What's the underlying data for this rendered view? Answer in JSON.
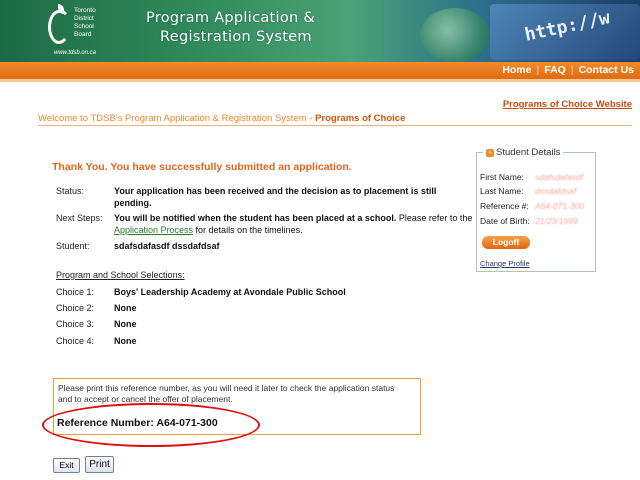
{
  "header": {
    "logo_lines": [
      "Toronto",
      "District",
      "School",
      "Board"
    ],
    "logo_url": "www.tdsb.on.ca",
    "title_line1": "Program Application &",
    "title_line2": "Registration System",
    "decor_text": "http://w"
  },
  "nav": {
    "items": [
      {
        "label": "Home"
      },
      {
        "label": "FAQ"
      },
      {
        "label": "Contact Us"
      }
    ],
    "separator": "|"
  },
  "programs_link": "Programs of Choice Website",
  "breadcrumb": {
    "prefix": "Welcome to TDSB's Program Application & Registration System - ",
    "current": "Programs of Choice"
  },
  "confirmation": {
    "heading": "Thank You. You have successfully submitted an application.",
    "status_label": "Status:",
    "status_text": "Your application has been received and the decision as to placement is still pending.",
    "next_label": "Next Steps:",
    "next_bold": "You will be notified when the student has been placed at a school.",
    "next_pre_link": " Please refer to the ",
    "next_link": "Application Process",
    "next_post_link": " for details on the timelines.",
    "student_label": "Student:",
    "student_name": "sdafsdafasdf  dssdafdsaf"
  },
  "selections": {
    "heading": "Program and School Selections:",
    "choices": [
      {
        "label": "Choice 1:",
        "value": "Boys' Leadership Academy at Avondale Public School"
      },
      {
        "label": "Choice 2:",
        "value": "None"
      },
      {
        "label": "Choice 3:",
        "value": "None"
      },
      {
        "label": "Choice 4:",
        "value": "None"
      }
    ]
  },
  "reference": {
    "note": "Please print this reference number, as you will need it later to check the application status and to accept or cancel the offer of placement.",
    "number_text": "Reference Number: A64-071-300"
  },
  "buttons": {
    "exit": "Exit",
    "print": "Print"
  },
  "student_details": {
    "title": "Student Details",
    "icon_glyph": "»",
    "first_name_label": "First Name:",
    "first_name_value": "sdafsdafasdf",
    "last_name_label": "Last Name:",
    "last_name_value": "dssdafdsaf",
    "reference_label": "Reference #:",
    "reference_value": "A64-071-300",
    "dob_label": "Date of Birth:",
    "dob_value": "21/23/1999",
    "logoff": "Logoff",
    "change_profile": "Change Profile"
  },
  "colors": {
    "accent_orange": "#e0661c",
    "nav_orange": "#f38b2c",
    "highlight_red": "#e01010",
    "link_green": "#2a7a2a"
  }
}
